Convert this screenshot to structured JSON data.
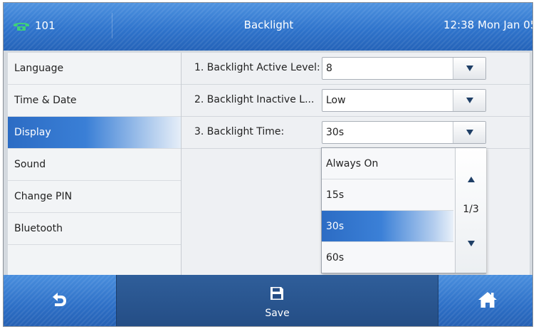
{
  "header": {
    "account": "101",
    "title": "Backlight",
    "datetime": "12:38 Mon Jan 05"
  },
  "sidebar": {
    "items": [
      {
        "label": "Language",
        "active": false
      },
      {
        "label": "Time & Date",
        "active": false
      },
      {
        "label": "Display",
        "active": true
      },
      {
        "label": "Sound",
        "active": false
      },
      {
        "label": "Change PIN",
        "active": false
      },
      {
        "label": "Bluetooth",
        "active": false
      }
    ]
  },
  "settings": [
    {
      "label": "1. Backlight Active Level:",
      "value": "8"
    },
    {
      "label": "2. Backlight Inactive L...",
      "value": "Low"
    },
    {
      "label": "3. Backlight Time:",
      "value": "30s"
    }
  ],
  "dropdown": {
    "options": [
      "Always On",
      "15s",
      "30s",
      "60s"
    ],
    "selected": "30s",
    "page": "1/3"
  },
  "softkeys": {
    "back_icon": "back-arrow-icon",
    "save_label": "Save",
    "save_icon": "floppy-disk-icon",
    "home_icon": "home-icon"
  },
  "colors": {
    "bar_blue": "#2f74cc",
    "highlight_blue": "#2c6cc4",
    "accent_green": "#3fd07a"
  }
}
